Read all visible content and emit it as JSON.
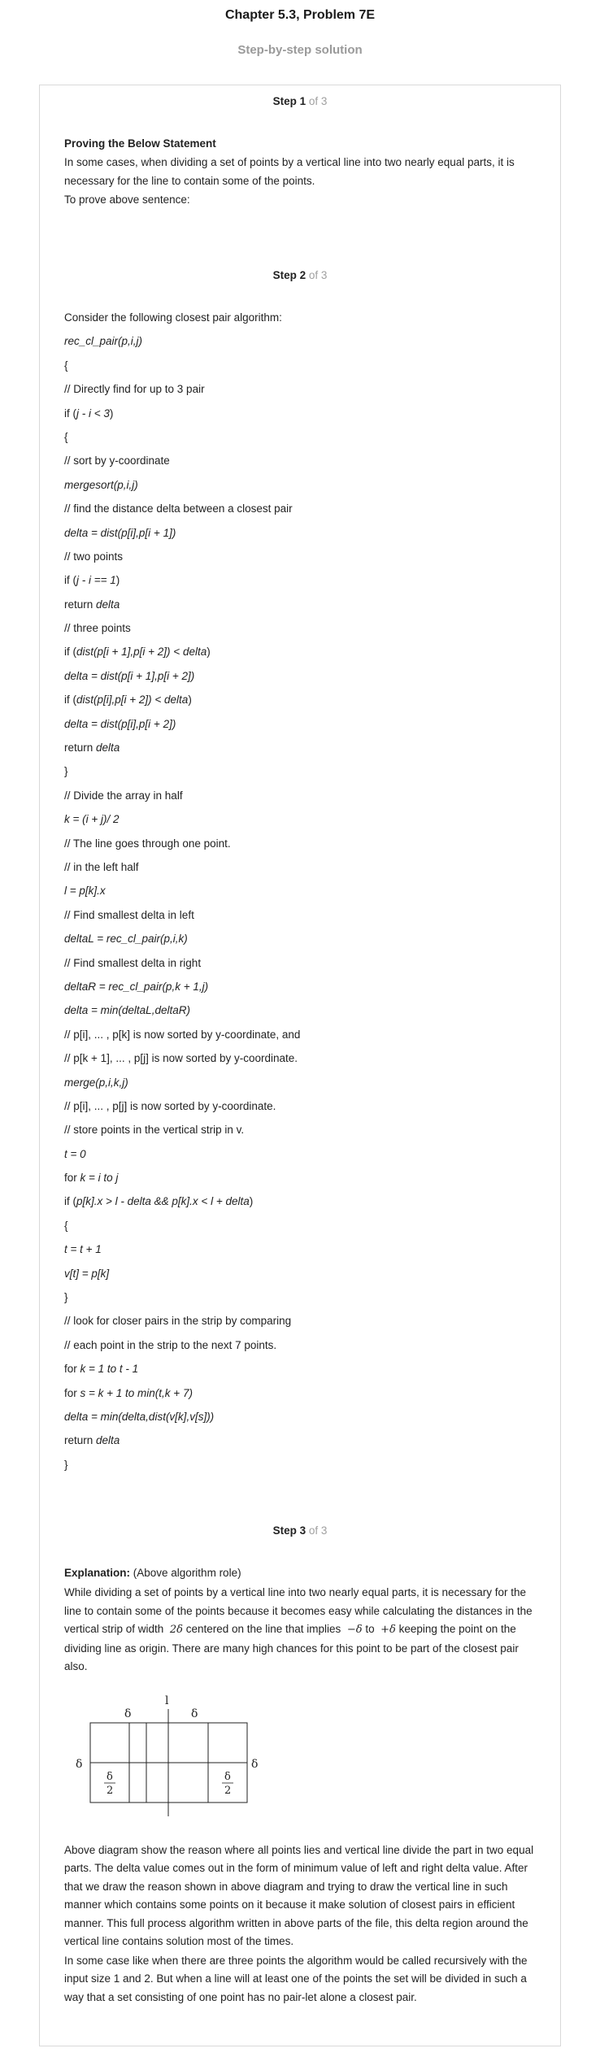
{
  "header": {
    "title": "Chapter 5.3, Problem 7E",
    "subtitle": "Step-by-step solution"
  },
  "step1": {
    "label": "Step 1",
    "of": " of 3",
    "heading": "Proving the Below Statement",
    "para1": "In some cases, when dividing a set of points by a vertical line into two nearly equal parts, it is necessary for the line to contain some of the points.",
    "para2": "To prove above sentence:"
  },
  "step2": {
    "label": "Step 2",
    "of": " of 3",
    "intro": "Consider the following closest pair algorithm:",
    "lines": [
      [
        {
          "t": "rec_cl_pair(p,i,j)",
          "i": true
        }
      ],
      [
        {
          "t": "{"
        }
      ],
      [
        {
          "t": "// Directly find for up to 3 pair"
        }
      ],
      [
        {
          "t": "if ("
        },
        {
          "t": "j - i < 3",
          "i": true
        },
        {
          "t": ")"
        }
      ],
      [
        {
          "t": "{"
        }
      ],
      [
        {
          "t": "// sort by y-coordinate"
        }
      ],
      [
        {
          "t": "mergesort(p,i,j)",
          "i": true
        }
      ],
      [
        {
          "t": "// find the distance delta between a closest pair"
        }
      ],
      [
        {
          "t": "delta = dist(p[i],p[i + 1])",
          "i": true
        }
      ],
      [
        {
          "t": "// two points"
        }
      ],
      [
        {
          "t": "if ("
        },
        {
          "t": "j - i == 1",
          "i": true
        },
        {
          "t": ")"
        }
      ],
      [
        {
          "t": "return "
        },
        {
          "t": "delta",
          "i": true
        }
      ],
      [
        {
          "t": "// three points"
        }
      ],
      [
        {
          "t": "if ("
        },
        {
          "t": "dist(p[i + 1],p[i + 2]) < delta",
          "i": true
        },
        {
          "t": ")"
        }
      ],
      [
        {
          "t": "delta = dist(p[i + 1],p[i + 2])",
          "i": true
        }
      ],
      [
        {
          "t": "if ("
        },
        {
          "t": "dist(p[i],p[i + 2]) < delta",
          "i": true
        },
        {
          "t": ")"
        }
      ],
      [
        {
          "t": "delta = dist(p[i],p[i + 2])",
          "i": true
        }
      ],
      [
        {
          "t": "return "
        },
        {
          "t": "delta",
          "i": true
        }
      ],
      [
        {
          "t": "}"
        }
      ],
      [
        {
          "t": "// Divide the array in half"
        }
      ],
      [
        {
          "t": "k = (i + j)/ 2",
          "i": true
        }
      ],
      [
        {
          "t": "// The line goes through one point."
        }
      ],
      [
        {
          "t": "// in the left half"
        }
      ],
      [
        {
          "t": "l = p[k].x",
          "i": true
        }
      ],
      [
        {
          "t": "// Find smallest delta in left"
        }
      ],
      [
        {
          "t": "deltaL = rec_cl_pair(p,i,k)",
          "i": true
        }
      ],
      [
        {
          "t": "// Find smallest delta in right"
        }
      ],
      [
        {
          "t": "deltaR = rec_cl_pair(p,k + 1,j)",
          "i": true
        }
      ],
      [
        {
          "t": "delta = min(deltaL,deltaR)",
          "i": true
        }
      ],
      [
        {
          "t": "// p[i], ... , p[k] is now sorted by y-coordinate, and"
        }
      ],
      [
        {
          "t": "// p[k + 1], ... , p[j] is now sorted by y-coordinate."
        }
      ],
      [
        {
          "t": "merge(p,i,k,j)",
          "i": true
        }
      ],
      [
        {
          "t": "// p[i], ... , p[j] is now sorted by y-coordinate."
        }
      ],
      [
        {
          "t": "// store points in the vertical strip in v."
        }
      ],
      [
        {
          "t": "t = 0",
          "i": true
        }
      ],
      [
        {
          "t": "for "
        },
        {
          "t": "k = i to j",
          "i": true
        }
      ],
      [
        {
          "t": "if ("
        },
        {
          "t": "p[k].x > l - delta && p[k].x < l + delta",
          "i": true
        },
        {
          "t": ")"
        }
      ],
      [
        {
          "t": "{"
        }
      ],
      [
        {
          "t": "t = t + 1",
          "i": true
        }
      ],
      [
        {
          "t": "v[t] = p[k]",
          "i": true
        }
      ],
      [
        {
          "t": "}"
        }
      ],
      [
        {
          "t": "// look for closer pairs in the strip by comparing"
        }
      ],
      [
        {
          "t": "// each point in the strip to the next 7 points."
        }
      ],
      [
        {
          "t": "for "
        },
        {
          "t": "k = 1 to t - 1",
          "i": true
        }
      ],
      [
        {
          "t": "for "
        },
        {
          "t": "s = k + 1 to min(t,k + 7)",
          "i": true
        }
      ],
      [
        {
          "t": "delta = min(delta,dist(v[k],v[s]))",
          "i": true
        }
      ],
      [
        {
          "t": "return "
        },
        {
          "t": "delta",
          "i": true
        }
      ],
      [
        {
          "t": "}"
        }
      ]
    ]
  },
  "step3": {
    "label": "Step 3",
    "of": " of 3",
    "expl_label": "Explanation:",
    "expl_rest": " (Above algorithm role)",
    "para1_a": "While dividing a set of points by a vertical line into two nearly equal parts, it is necessary for the line to contain some of the points because it becomes easy while calculating the distances in the vertical strip of width",
    "math_2d": "2δ",
    "para1_b": "centered on the line that implies",
    "math_neg": "−δ",
    "para1_to": "to",
    "math_pos": "+δ",
    "para1_c": "keeping the point on the dividing line as origin. There are many high chances for this point to be part of the closest pair also.",
    "diagram": {
      "line_label": "l",
      "delta": "δ",
      "half_num": "δ",
      "half_den": "2"
    },
    "para2": "Above diagram show the reason where all points lies and vertical line divide the part in two equal parts. The delta value comes out in the form of minimum value of left and right delta value. After that we draw the reason shown in above diagram and trying to draw the vertical line in such manner which contains some points on it because it make solution of closest pairs in efficient manner. This full process algorithm written in above parts of the file, this delta region around the vertical line contains solution most of the times.",
    "para3": "In some case like when there are three points the algorithm would be called recursively with the input size 1 and 2. But when a line will at least one of the points the set will be divided in such a way that a set consisting of one point has no pair-let alone a closest pair."
  }
}
